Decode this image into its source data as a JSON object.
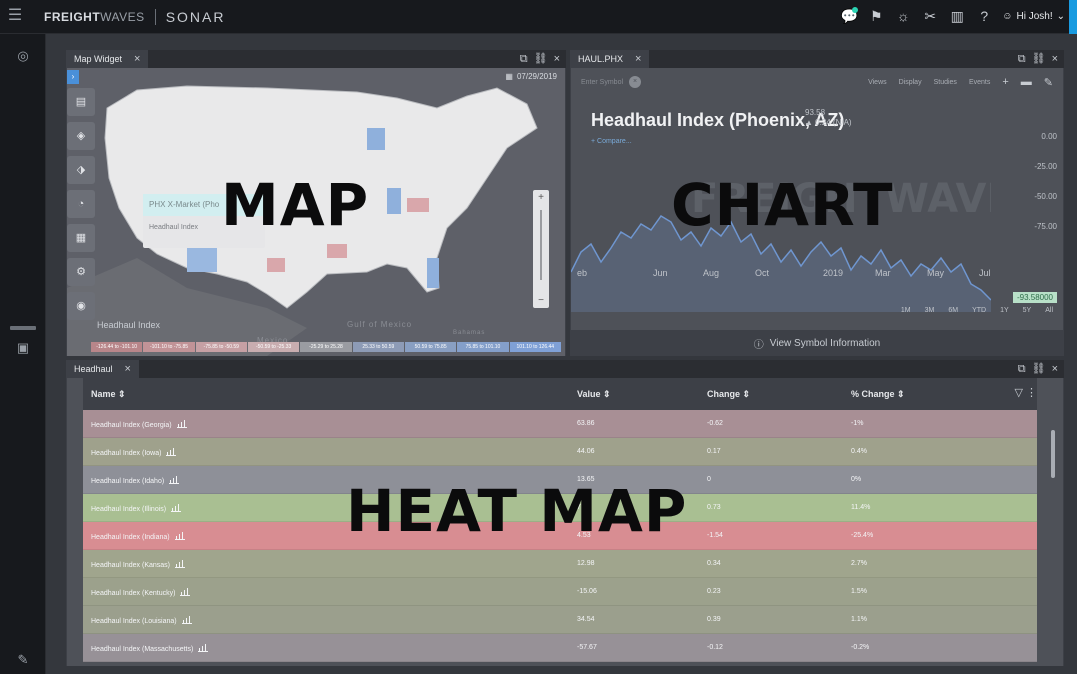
{
  "brand": {
    "name_bold": "FREIGHT",
    "name_light": "WAVES",
    "product": "SONAR"
  },
  "user": {
    "greeting": "Hi Josh!"
  },
  "map_widget": {
    "tab": "Map Widget",
    "date": "07/29/2019",
    "popup_title": "PHX X-Market (Pho",
    "popup_row": "Headhaul Index",
    "legend_label": "Headhaul Index",
    "place_labels": [
      "Mexico",
      "Gulf of Mexico",
      "Bahamas"
    ],
    "legend_ranges": [
      "-126.44 to -101.10",
      "-101.10 to -75.85",
      "-75.85 to -50.59",
      "-50.59 to -25.33",
      "-25.29 to 25.28",
      "25.33 to 50.59",
      "50.59 to 75.85",
      "75.85 to 101.10",
      "101.10 to 126.44"
    ],
    "legend_colors": [
      "#b8868a",
      "#c19397",
      "#c6a0a4",
      "#c8adb0",
      "#9a9ca2",
      "#8d9bb6",
      "#899fc2",
      "#849fca",
      "#7fa0d6"
    ],
    "overlay": "MAP"
  },
  "chart_widget": {
    "tab": "HAUL.PHX",
    "symbol_placeholder": "Enter Symbol",
    "menus": [
      "Views",
      "Display",
      "Studies",
      "Events"
    ],
    "title": "Headhaul Index (Phoenix, AZ)",
    "price": "93.58",
    "change": "▲ 0.24 (N/A)",
    "compare": "+ Compare...",
    "y_ticks": [
      "0.00",
      "-25.00",
      "-50.00",
      "-75.00"
    ],
    "last_value": "-93.58000",
    "x_ticks": [
      "eb",
      "Jun",
      "Aug",
      "Oct",
      "2019",
      "Mar",
      "May",
      "Jul"
    ],
    "ranges": [
      "1M",
      "3M",
      "6M",
      "YTD",
      "1Y",
      "5Y",
      "All"
    ],
    "footer": "View Symbol Information",
    "overlay": "CHART",
    "watermark": "FREIGHTWAVES"
  },
  "heat_widget": {
    "tab": "Headhaul",
    "columns": [
      "Name",
      "Value",
      "Change",
      "% Change"
    ],
    "rows": [
      {
        "name": "Headhaul Index (Georgia)",
        "value": "63.86",
        "change": "-0.62",
        "pct": "-1%",
        "color": "#a88f95"
      },
      {
        "name": "Headhaul Index (Iowa)",
        "value": "44.06",
        "change": "0.17",
        "pct": "0.4%",
        "color": "#9fa18c"
      },
      {
        "name": "Headhaul Index (Idaho)",
        "value": "13.65",
        "change": "0",
        "pct": "0%",
        "color": "#8e9098"
      },
      {
        "name": "Headhaul Index (Illinois)",
        "value": "7.11",
        "change": "0.73",
        "pct": "11.4%",
        "color": "#a9bf92"
      },
      {
        "name": "Headhaul Index (Indiana)",
        "value": "4.53",
        "change": "-1.54",
        "pct": "-25.4%",
        "color": "#d88d92"
      },
      {
        "name": "Headhaul Index (Kansas)",
        "value": "12.98",
        "change": "0.34",
        "pct": "2.7%",
        "color": "#a0a58d"
      },
      {
        "name": "Headhaul Index (Kentucky)",
        "value": "-15.06",
        "change": "0.23",
        "pct": "1.5%",
        "color": "#9ca18c"
      },
      {
        "name": "Headhaul Index (Louisiana)",
        "value": "34.54",
        "change": "0.39",
        "pct": "1.1%",
        "color": "#9b9f8d"
      },
      {
        "name": "Headhaul Index (Massachusetts)",
        "value": "-57.67",
        "change": "-0.12",
        "pct": "-0.2%",
        "color": "#979197"
      }
    ],
    "overlay": "HEAT MAP"
  }
}
